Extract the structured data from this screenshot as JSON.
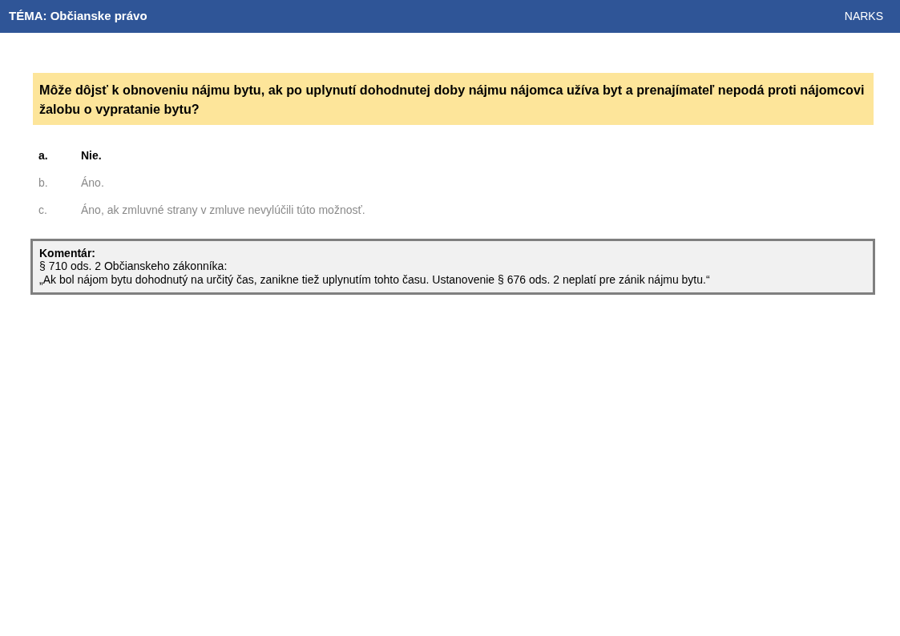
{
  "header": {
    "title": "TÉMA: Občianske právo",
    "brand": "NARKS"
  },
  "question": "Môže dôjsť k obnoveniu nájmu bytu, ak po uplynutí dohodnutej doby nájmu nájomca užíva byt a prenajímateľ nepodá proti nájomcovi žalobu o vypratanie bytu?",
  "answers": [
    {
      "letter": "a.",
      "text": "Nie.",
      "correct": true
    },
    {
      "letter": "b.",
      "text": "Áno.",
      "correct": false
    },
    {
      "letter": "c.",
      "text": "Áno, ak zmluvné strany v zmluve nevylúčili túto možnosť.",
      "correct": false
    }
  ],
  "comment": {
    "heading": "Komentár:",
    "lines": [
      "§ 710 ods. 2 Občianskeho zákonníka:",
      "„Ak bol nájom bytu dohodnutý na určitý čas, zanikne tiež uplynutím tohto času. Ustanovenie § 676 ods. 2 neplatí pre zánik nájmu bytu.“"
    ]
  }
}
